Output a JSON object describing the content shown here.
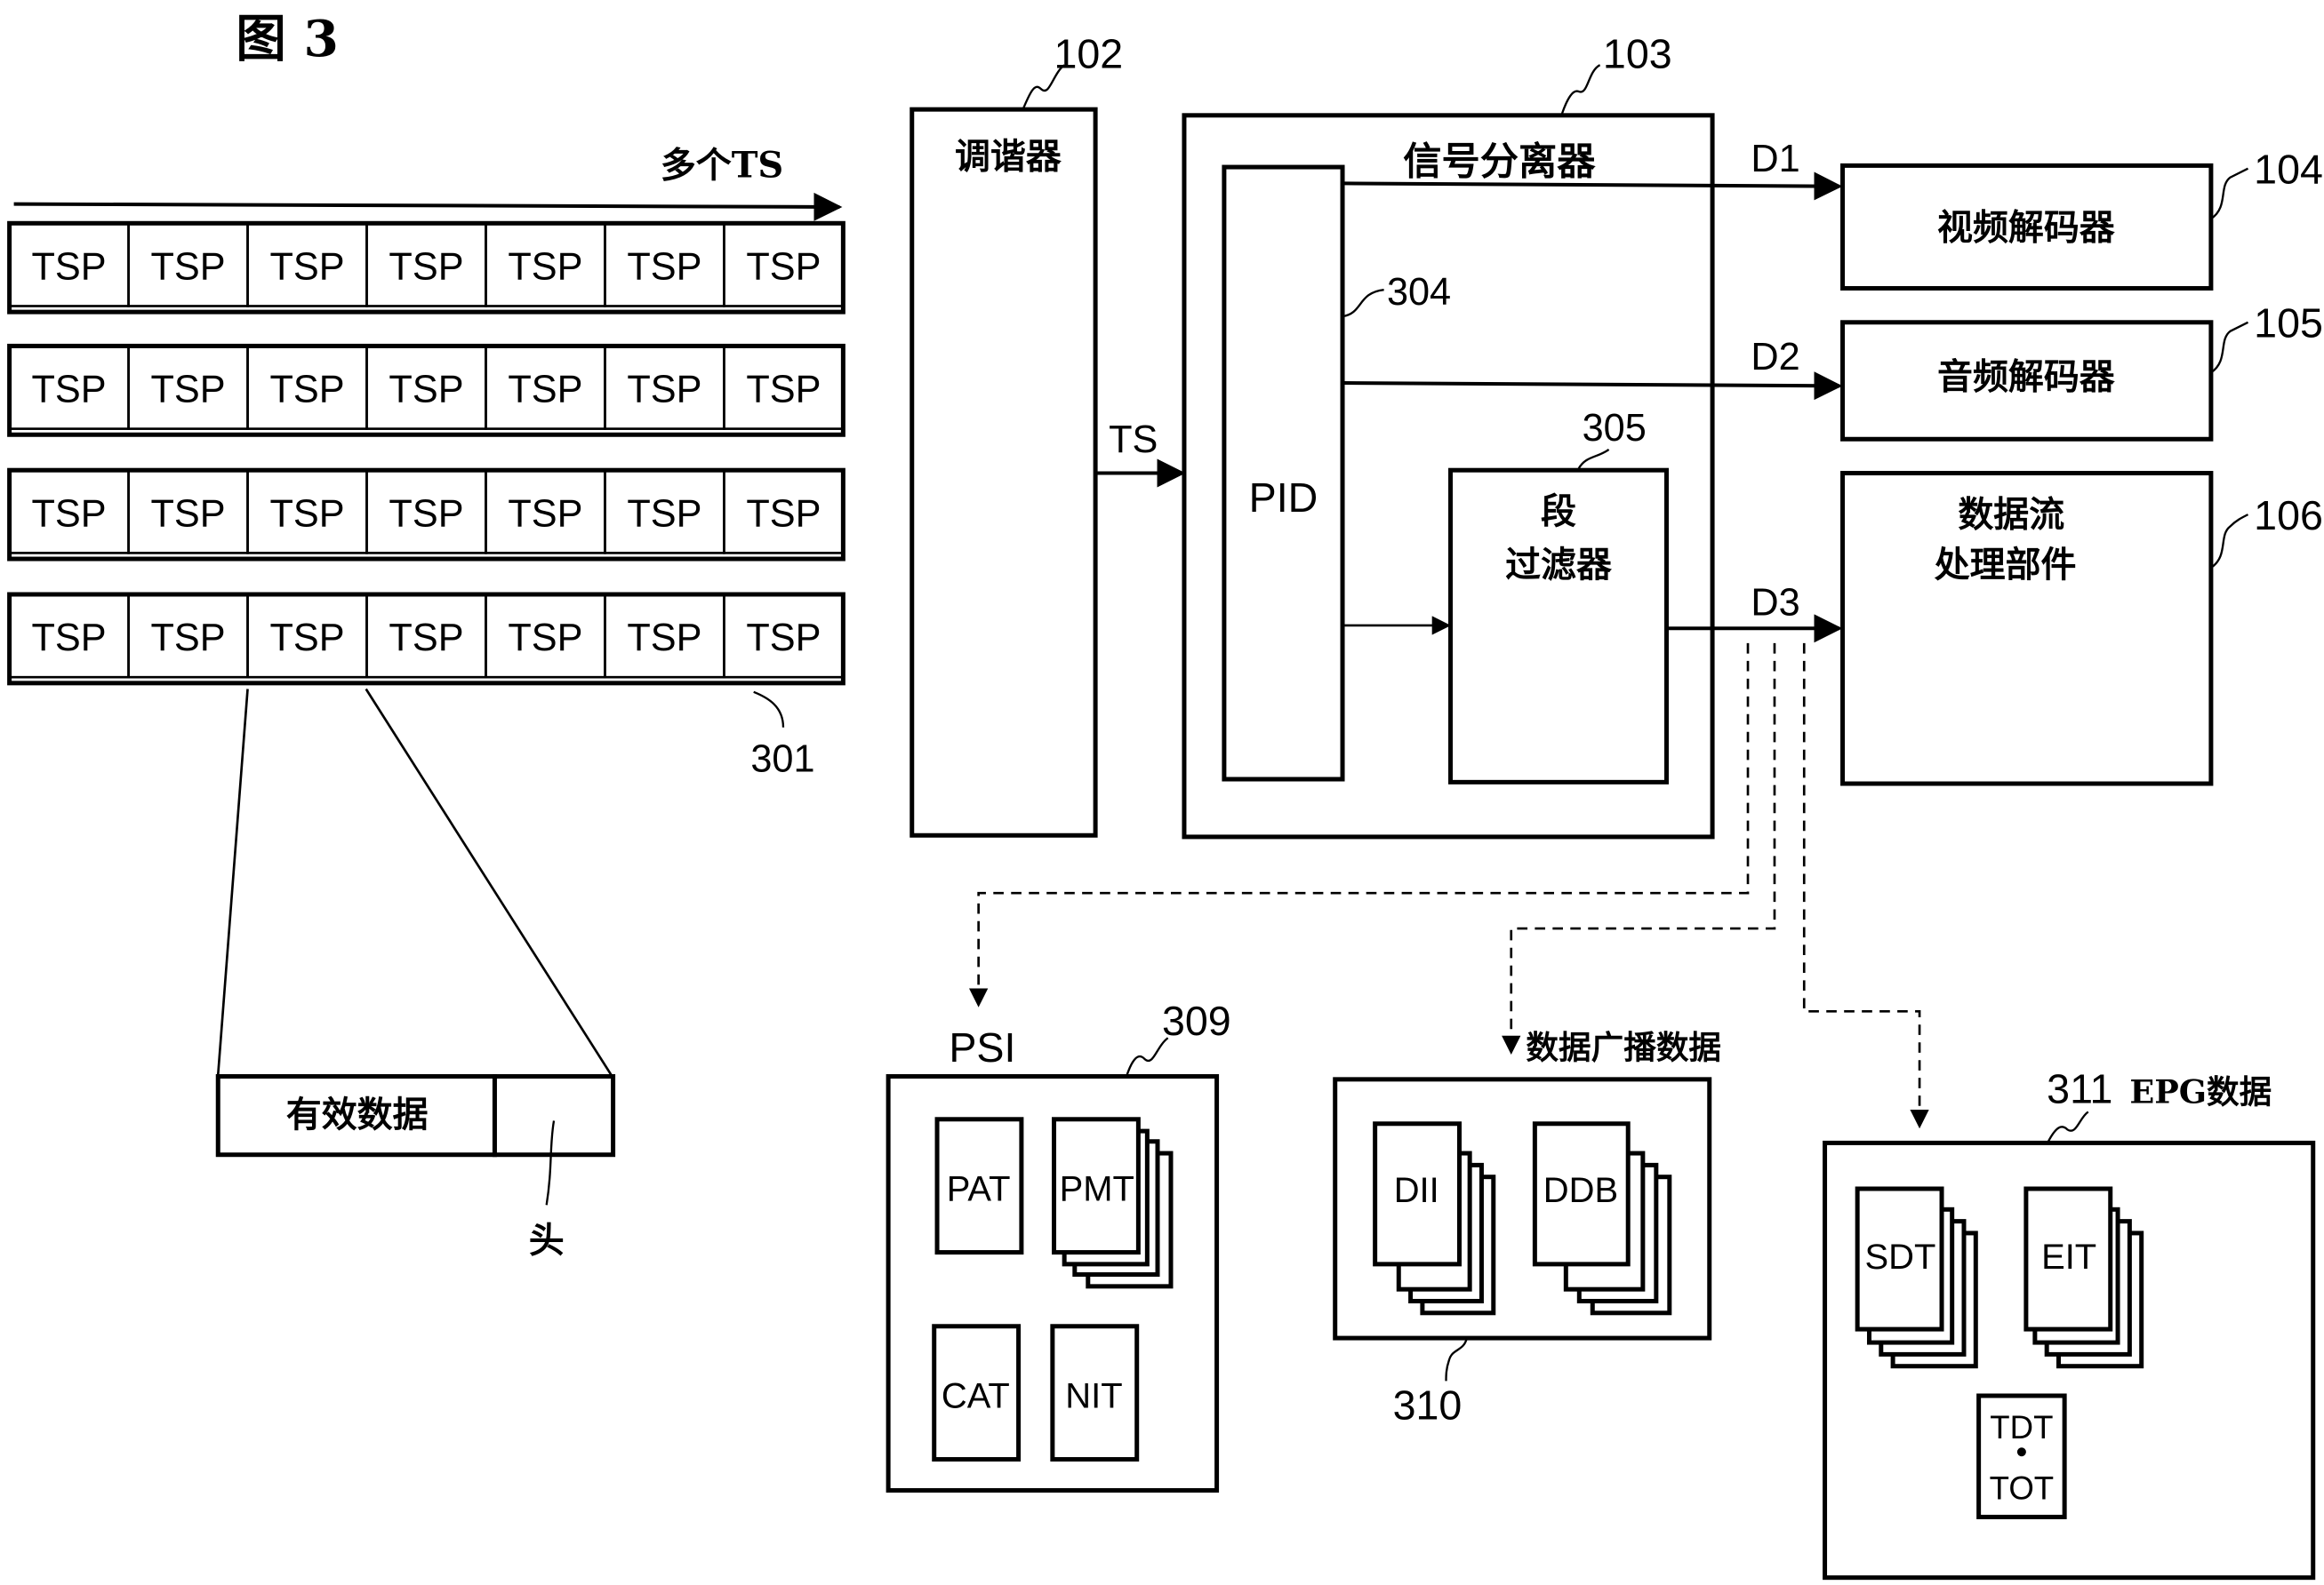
{
  "figure_title": "图 3",
  "stream": {
    "label": "多个TS",
    "rows": [
      [
        "TSP",
        "TSP",
        "TSP",
        "TSP",
        "TSP",
        "TSP",
        "TSP"
      ],
      [
        "TSP",
        "TSP",
        "TSP",
        "TSP",
        "TSP",
        "TSP",
        "TSP"
      ],
      [
        "TSP",
        "TSP",
        "TSP",
        "TSP",
        "TSP",
        "TSP",
        "TSP"
      ],
      [
        "TSP",
        "TSP",
        "TSP",
        "TSP",
        "TSP",
        "TSP",
        "TSP"
      ]
    ],
    "ref": "301",
    "packet": {
      "payload_label": "有效数据",
      "header_label": "头"
    }
  },
  "tuner": {
    "label": "调谐器",
    "ref": "102",
    "output_label": "TS"
  },
  "demux": {
    "label": "信号分离器",
    "ref": "103",
    "pid": {
      "label": "PID",
      "ref": "304"
    },
    "section_filter": {
      "label_line1": "段",
      "label_line2": "过滤器",
      "ref": "305"
    }
  },
  "outputs": [
    {
      "signal": "D1",
      "label": "视频解码器",
      "ref": "104"
    },
    {
      "signal": "D2",
      "label": "音频解码器",
      "ref": "105"
    },
    {
      "signal": "D3",
      "label_line1": "数据流",
      "label_line2": "处理部件",
      "ref": "106"
    }
  ],
  "psi": {
    "title": "PSI",
    "ref": "309",
    "tables": [
      "PAT",
      "PMT",
      "CAT",
      "NIT"
    ]
  },
  "data_broadcast": {
    "title": "数据广播数据",
    "ref": "310",
    "tables": [
      "DII",
      "DDB"
    ]
  },
  "epg": {
    "title": "EPG数据",
    "ref": "311",
    "tables": [
      "SDT",
      "EIT"
    ],
    "time_table_line1": "TDT",
    "time_table_line2": "TOT"
  }
}
